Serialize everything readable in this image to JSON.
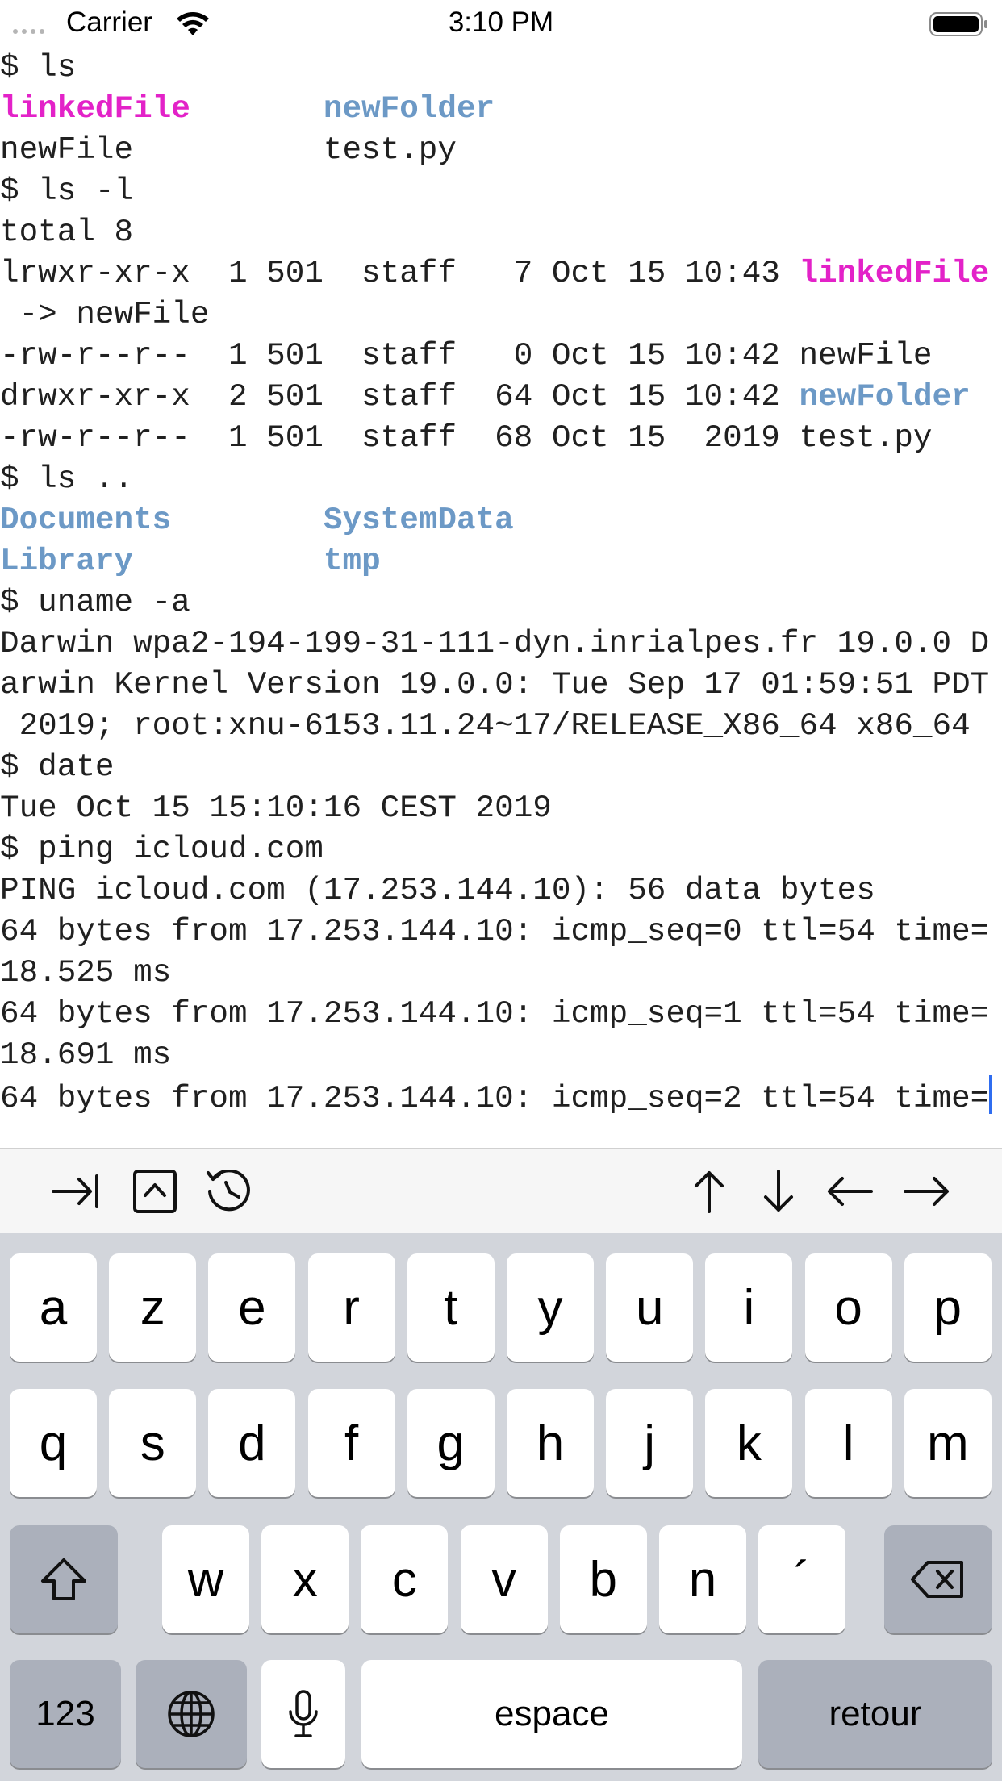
{
  "status_bar": {
    "carrier": "Carrier",
    "time": "3:10 PM"
  },
  "terminal": {
    "lines": [
      [
        {
          "t": "$ ls",
          "c": ""
        }
      ],
      [
        {
          "t": "linkedFile",
          "c": "link"
        },
        {
          "t": "       ",
          "c": ""
        },
        {
          "t": "newFolder",
          "c": "dir"
        }
      ],
      [
        {
          "t": "newFile          test.py",
          "c": ""
        }
      ],
      [
        {
          "t": "$ ls -l",
          "c": ""
        }
      ],
      [
        {
          "t": "total 8",
          "c": ""
        }
      ],
      [
        {
          "t": "lrwxr-xr-x  1 501  staff   7 Oct 15 10:43 ",
          "c": ""
        },
        {
          "t": "linkedFile",
          "c": "link"
        }
      ],
      [
        {
          "t": " -> newFile",
          "c": ""
        }
      ],
      [
        {
          "t": "-rw-r--r--  1 501  staff   0 Oct 15 10:42 newFile",
          "c": ""
        }
      ],
      [
        {
          "t": "drwxr-xr-x  2 501  staff  64 Oct 15 10:42 ",
          "c": ""
        },
        {
          "t": "newFolder",
          "c": "dir"
        }
      ],
      [
        {
          "t": "-rw-r--r--  1 501  staff  68 Oct 15  2019 test.py",
          "c": ""
        }
      ],
      [
        {
          "t": "$ ls ..",
          "c": ""
        }
      ],
      [
        {
          "t": "Documents",
          "c": "dir"
        },
        {
          "t": "        ",
          "c": ""
        },
        {
          "t": "SystemData",
          "c": "dir"
        }
      ],
      [
        {
          "t": "Library",
          "c": "dir"
        },
        {
          "t": "          ",
          "c": ""
        },
        {
          "t": "tmp",
          "c": "dir"
        }
      ],
      [
        {
          "t": "$ uname -a",
          "c": ""
        }
      ],
      [
        {
          "t": "Darwin wpa2-194-199-31-111-dyn.inrialpes.fr 19.0.0 D",
          "c": ""
        }
      ],
      [
        {
          "t": "arwin Kernel Version 19.0.0: Tue Sep 17 01:59:51 PDT",
          "c": ""
        }
      ],
      [
        {
          "t": " 2019; root:xnu-6153.11.24~17/RELEASE_X86_64 x86_64",
          "c": ""
        }
      ],
      [
        {
          "t": "$ date",
          "c": ""
        }
      ],
      [
        {
          "t": "Tue Oct 15 15:10:16 CEST 2019",
          "c": ""
        }
      ],
      [
        {
          "t": "$ ping icloud.com",
          "c": ""
        }
      ],
      [
        {
          "t": "PING icloud.com (17.253.144.10): 56 data bytes",
          "c": ""
        }
      ],
      [
        {
          "t": "64 bytes from 17.253.144.10: icmp_seq=0 ttl=54 time=",
          "c": ""
        }
      ],
      [
        {
          "t": "18.525 ms",
          "c": ""
        }
      ],
      [
        {
          "t": "64 bytes from 17.253.144.10: icmp_seq=1 ttl=54 time=",
          "c": ""
        }
      ],
      [
        {
          "t": "18.691 ms",
          "c": ""
        }
      ],
      [
        {
          "t": "64 bytes from 17.253.144.10: icmp_seq=2 ttl=54 time=",
          "c": ""
        },
        {
          "t": "",
          "c": "cursor"
        }
      ]
    ]
  },
  "toolbar": {
    "icons": [
      "tab-icon",
      "control-icon",
      "history-icon",
      "arrow-up-icon",
      "arrow-down-icon",
      "arrow-left-icon",
      "arrow-right-icon"
    ]
  },
  "keyboard": {
    "row1": [
      "a",
      "z",
      "e",
      "r",
      "t",
      "y",
      "u",
      "i",
      "o",
      "p"
    ],
    "row2": [
      "q",
      "s",
      "d",
      "f",
      "g",
      "h",
      "j",
      "k",
      "l",
      "m"
    ],
    "row3": [
      "w",
      "x",
      "c",
      "v",
      "b",
      "n",
      "´"
    ],
    "numbers_label": "123",
    "space_label": "espace",
    "return_label": "retour"
  }
}
